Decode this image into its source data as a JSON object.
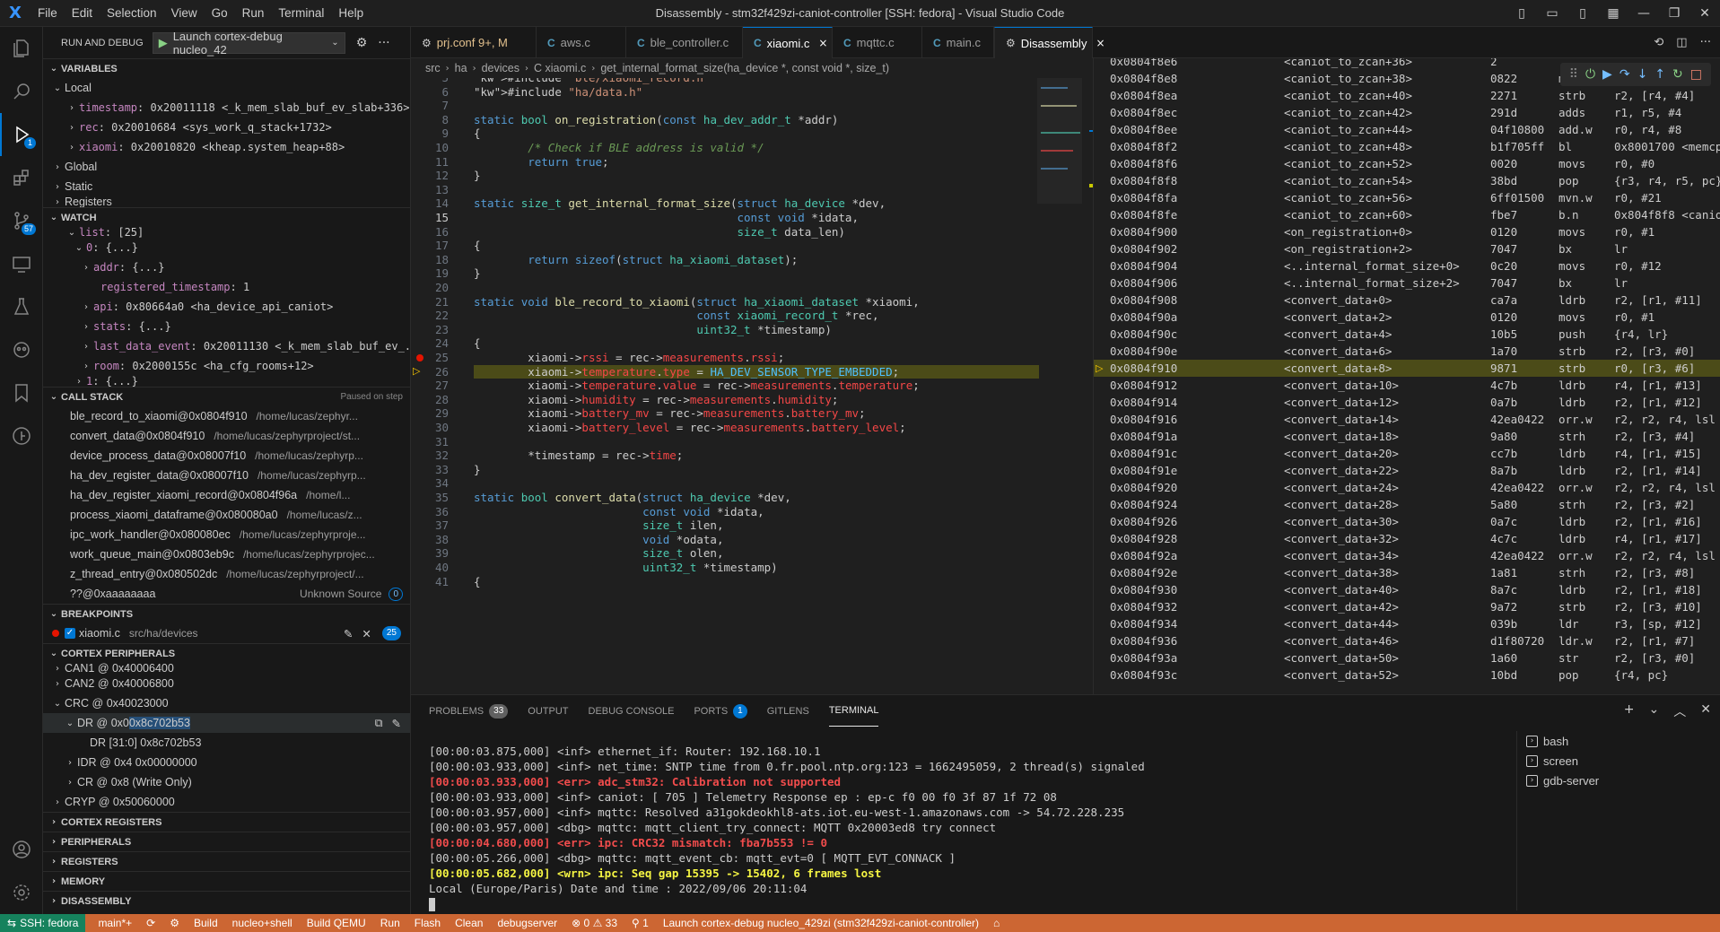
{
  "titlebar": {
    "logo": "X",
    "menu": [
      "File",
      "Edit",
      "Selection",
      "View",
      "Go",
      "Run",
      "Terminal",
      "Help"
    ],
    "title": "Disassembly - stm32f429zi-caniot-controller [SSH: fedora] - Visual Studio Code"
  },
  "activity": {
    "debug_badge": "1",
    "scm_badge": "57"
  },
  "sidebar": {
    "header": "RUN AND DEBUG",
    "launch": "Launch cortex-debug nucleo_42",
    "variables": {
      "title": "VARIABLES",
      "local": "Local",
      "items": [
        {
          "name": "timestamp",
          "value": ": 0x20011118 <_k_mem_slab_buf_ev_slab+336>"
        },
        {
          "name": "rec",
          "value": ": 0x20010684 <sys_work_q_stack+1732>"
        },
        {
          "name": "xiaomi",
          "value": ": 0x20010820 <kheap.system_heap+88>"
        }
      ],
      "global": "Global",
      "static": "Static",
      "registers": "Registers"
    },
    "watch": {
      "title": "WATCH",
      "rows": [
        {
          "name": "list",
          "value": ": [25]"
        },
        {
          "name": "0",
          "value": ": {...}"
        },
        {
          "name": "addr",
          "value": ": {...}"
        },
        {
          "name": "registered_timestamp",
          "value": ": 1"
        },
        {
          "name": "api",
          "value": ": 0x80664a0 <ha_device_api_caniot>"
        },
        {
          "name": "stats",
          "value": ": {...}"
        },
        {
          "name": "last_data_event",
          "value": ": 0x20011130 <_k_mem_slab_buf_ev_..."
        },
        {
          "name": "room",
          "value": ": 0x2000155c <ha_cfg_rooms+12>"
        },
        {
          "name": "1",
          "value": ": {...}"
        }
      ]
    },
    "callstack": {
      "title": "CALL STACK",
      "status": "Paused on step",
      "frames": [
        {
          "fn": "ble_record_to_xiaomi@0x0804f910",
          "path": "/home/lucas/zephyr..."
        },
        {
          "fn": "convert_data@0x0804f910",
          "path": "/home/lucas/zephyrproject/st..."
        },
        {
          "fn": "device_process_data@0x08007f10",
          "path": "/home/lucas/zephyrp..."
        },
        {
          "fn": "ha_dev_register_data@0x08007f10",
          "path": "/home/lucas/zephyrp..."
        },
        {
          "fn": "ha_dev_register_xiaomi_record@0x0804f96a",
          "path": "/home/l..."
        },
        {
          "fn": "process_xiaomi_dataframe@0x080080a0",
          "path": "/home/lucas/z..."
        },
        {
          "fn": "ipc_work_handler@0x080080ec",
          "path": "/home/lucas/zephyrproje..."
        },
        {
          "fn": "work_queue_main@0x0803eb9c",
          "path": "/home/lucas/zephyrprojec..."
        },
        {
          "fn": "z_thread_entry@0x080502dc",
          "path": "/home/lucas/zephyrproject/..."
        },
        {
          "fn": "??@0xaaaaaaaa",
          "path": "Unknown Source",
          "badge": "0"
        }
      ]
    },
    "breakpoints": {
      "title": "BREAKPOINTS",
      "file": "xiaomi.c",
      "path": "src/ha/devices",
      "count": "25"
    },
    "peripherals": {
      "title": "CORTEX PERIPHERALS",
      "rows": [
        {
          "label": "CAN1 @ 0x40006400",
          "indent": 1
        },
        {
          "label": "CAN2 @ 0x40006800",
          "indent": 1
        },
        {
          "label": "CRC @ 0x40023000",
          "indent": 1
        },
        {
          "label": "DR @ 0x0 ",
          "value": "0x8c702b53",
          "indent": 2
        },
        {
          "label": "DR [31:0] 0x8c702b53",
          "indent": 3
        },
        {
          "label": "IDR @ 0x4 0x00000000",
          "indent": 2
        },
        {
          "label": "CR @ 0x8 (Write Only)",
          "indent": 2
        },
        {
          "label": "CRYP @ 0x50060000",
          "indent": 1
        }
      ]
    },
    "bottom_sections": [
      "CORTEX REGISTERS",
      "PERIPHERALS",
      "REGISTERS",
      "MEMORY",
      "DISASSEMBLY"
    ]
  },
  "tabs": [
    {
      "icon": "⚙",
      "label": "prj.conf 9+, M",
      "modified": true
    },
    {
      "icon": "C",
      "label": "aws.c"
    },
    {
      "icon": "C",
      "label": "ble_controller.c"
    },
    {
      "icon": "C",
      "label": "xiaomi.c",
      "active": true,
      "close": "×"
    },
    {
      "icon": "C",
      "label": "mqttc.c"
    },
    {
      "icon": "C",
      "label": "main.c"
    },
    {
      "icon": "⚙",
      "label": "Disassembly",
      "active": true,
      "close": "×"
    }
  ],
  "breadcrumb": [
    "src",
    "ha",
    "devices",
    "C xiaomi.c",
    "get_internal_format_size(ha_device *, const void *, size_t)"
  ],
  "code": {
    "lines": [
      {
        "n": "5",
        "t": "#include \"ble/xiaomi_record.h\""
      },
      {
        "n": "6",
        "t": "#include \"ha/data.h\""
      },
      {
        "n": "7",
        "t": ""
      },
      {
        "n": "8",
        "t": "static bool on_registration(const ha_dev_addr_t *addr)"
      },
      {
        "n": "9",
        "t": "{"
      },
      {
        "n": "10",
        "t": "        /* Check if BLE address is valid */"
      },
      {
        "n": "11",
        "t": "        return true;"
      },
      {
        "n": "12",
        "t": "}"
      },
      {
        "n": "13",
        "t": ""
      },
      {
        "n": "14",
        "t": "static size_t get_internal_format_size(struct ha_device *dev,"
      },
      {
        "n": "15",
        "t": "                                       const void *idata,"
      },
      {
        "n": "16",
        "t": "                                       size_t data_len)"
      },
      {
        "n": "17",
        "t": "{"
      },
      {
        "n": "18",
        "t": "        return sizeof(struct ha_xiaomi_dataset);"
      },
      {
        "n": "19",
        "t": "}"
      },
      {
        "n": "20",
        "t": ""
      },
      {
        "n": "21",
        "t": "static void ble_record_to_xiaomi(struct ha_xiaomi_dataset *xiaomi,"
      },
      {
        "n": "22",
        "t": "                                 const xiaomi_record_t *rec,"
      },
      {
        "n": "23",
        "t": "                                 uint32_t *timestamp)"
      },
      {
        "n": "24",
        "t": "{"
      },
      {
        "n": "25",
        "t": "        xiaomi->rssi = rec->measurements.rssi;"
      },
      {
        "n": "26",
        "t": "        xiaomi->temperature.type = HA_DEV_SENSOR_TYPE_EMBEDDED;"
      },
      {
        "n": "27",
        "t": "        xiaomi->temperature.value = rec->measurements.temperature;"
      },
      {
        "n": "28",
        "t": "        xiaomi->humidity = rec->measurements.humidity;"
      },
      {
        "n": "29",
        "t": "        xiaomi->battery_mv = rec->measurements.battery_mv;"
      },
      {
        "n": "30",
        "t": "        xiaomi->battery_level = rec->measurements.battery_level;"
      },
      {
        "n": "31",
        "t": ""
      },
      {
        "n": "32",
        "t": "        *timestamp = rec->time;"
      },
      {
        "n": "33",
        "t": "}"
      },
      {
        "n": "34",
        "t": ""
      },
      {
        "n": "35",
        "t": "static bool convert_data(struct ha_device *dev,"
      },
      {
        "n": "36",
        "t": "                         const void *idata,"
      },
      {
        "n": "37",
        "t": "                         size_t ilen,"
      },
      {
        "n": "38",
        "t": "                         void *odata,"
      },
      {
        "n": "39",
        "t": "                         size_t olen,"
      },
      {
        "n": "40",
        "t": "                         uint32_t *timestamp)"
      },
      {
        "n": "41",
        "t": "{"
      }
    ]
  },
  "disasm": {
    "rows": [
      [
        "0x0804f8e6",
        "<caniot_to_zcan+36>",
        "2",
        "",
        ""
      ],
      [
        "0x0804f8e8",
        "<caniot_to_zcan+38>",
        "0822",
        "movs",
        "r2, #8"
      ],
      [
        "0x0804f8ea",
        "<caniot_to_zcan+40>",
        "2271",
        "strb",
        "r2, [r4, #4]"
      ],
      [
        "0x0804f8ec",
        "<caniot_to_zcan+42>",
        "291d",
        "adds",
        "r1, r5, #4"
      ],
      [
        "0x0804f8ee",
        "<caniot_to_zcan+44>",
        "04f10800",
        "add.w",
        "r0, r4, #8"
      ],
      [
        "0x0804f8f2",
        "<caniot_to_zcan+48>",
        "b1f705ff",
        "bl",
        "0x8001700 <memcpy>"
      ],
      [
        "0x0804f8f6",
        "<caniot_to_zcan+52>",
        "0020",
        "movs",
        "r0, #0"
      ],
      [
        "0x0804f8f8",
        "<caniot_to_zcan+54>",
        "38bd",
        "pop",
        "{r3, r4, r5, pc}"
      ],
      [
        "0x0804f8fa",
        "<caniot_to_zcan+56>",
        "6ff01500",
        "mvn.w",
        "r0, #21"
      ],
      [
        "0x0804f8fe",
        "<caniot_to_zcan+60>",
        "fbe7",
        "b.n",
        "0x804f8f8 <caniot_to"
      ],
      [
        "0x0804f900",
        "<on_registration+0>",
        "0120",
        "movs",
        "r0, #1"
      ],
      [
        "0x0804f902",
        "<on_registration+2>",
        "7047",
        "bx",
        "lr"
      ],
      [
        "0x0804f904",
        "<..internal_format_size+0>",
        "0c20",
        "movs",
        "r0, #12"
      ],
      [
        "0x0804f906",
        "<..internal_format_size+2>",
        "7047",
        "bx",
        "lr"
      ],
      [
        "0x0804f908",
        "<convert_data+0>",
        "ca7a",
        "ldrb",
        "r2, [r1, #11]"
      ],
      [
        "0x0804f90a",
        "<convert_data+2>",
        "0120",
        "movs",
        "r0, #1"
      ],
      [
        "0x0804f90c",
        "<convert_data+4>",
        "10b5",
        "push",
        "{r4, lr}"
      ],
      [
        "0x0804f90e",
        "<convert_data+6>",
        "1a70",
        "strb",
        "r2, [r3, #0]"
      ],
      [
        "0x0804f910",
        "<convert_data+8>",
        "9871",
        "strb",
        "r0, [r3, #6]"
      ],
      [
        "0x0804f912",
        "<convert_data+10>",
        "4c7b",
        "ldrb",
        "r4, [r1, #13]"
      ],
      [
        "0x0804f914",
        "<convert_data+12>",
        "0a7b",
        "ldrb",
        "r2, [r1, #12]"
      ],
      [
        "0x0804f916",
        "<convert_data+14>",
        "42ea0422",
        "orr.w",
        "r2, r2, r4, lsl #8"
      ],
      [
        "0x0804f91a",
        "<convert_data+18>",
        "9a80",
        "strh",
        "r2, [r3, #4]"
      ],
      [
        "0x0804f91c",
        "<convert_data+20>",
        "cc7b",
        "ldrb",
        "r4, [r1, #15]"
      ],
      [
        "0x0804f91e",
        "<convert_data+22>",
        "8a7b",
        "ldrb",
        "r2, [r1, #14]"
      ],
      [
        "0x0804f920",
        "<convert_data+24>",
        "42ea0422",
        "orr.w",
        "r2, r2, r4, lsl #8"
      ],
      [
        "0x0804f924",
        "<convert_data+28>",
        "5a80",
        "strh",
        "r2, [r3, #2]"
      ],
      [
        "0x0804f926",
        "<convert_data+30>",
        "0a7c",
        "ldrb",
        "r2, [r1, #16]"
      ],
      [
        "0x0804f928",
        "<convert_data+32>",
        "4c7c",
        "ldrb",
        "r4, [r1, #17]"
      ],
      [
        "0x0804f92a",
        "<convert_data+34>",
        "42ea0422",
        "orr.w",
        "r2, r2, r4, lsl #8"
      ],
      [
        "0x0804f92e",
        "<convert_data+38>",
        "1a81",
        "strh",
        "r2, [r3, #8]"
      ],
      [
        "0x0804f930",
        "<convert_data+40>",
        "8a7c",
        "ldrb",
        "r2, [r1, #18]"
      ],
      [
        "0x0804f932",
        "<convert_data+42>",
        "9a72",
        "strb",
        "r2, [r3, #10]"
      ],
      [
        "0x0804f934",
        "<convert_data+44>",
        "039b",
        "ldr",
        "r3, [sp, #12]"
      ],
      [
        "0x0804f936",
        "<convert_data+46>",
        "d1f80720",
        "ldr.w",
        "r2, [r1, #7]"
      ],
      [
        "0x0804f93a",
        "<convert_data+50>",
        "1a60",
        "str",
        "r2, [r3, #0]"
      ],
      [
        "0x0804f93c",
        "<convert_data+52>",
        "10bd",
        "pop",
        "{r4, pc}"
      ]
    ]
  },
  "panel": {
    "tabs": [
      {
        "label": "PROBLEMS",
        "badge": "33"
      },
      {
        "label": "OUTPUT"
      },
      {
        "label": "DEBUG CONSOLE"
      },
      {
        "label": "PORTS",
        "badge": "1"
      },
      {
        "label": "GITLENS"
      },
      {
        "label": "TERMINAL",
        "active": true
      }
    ],
    "terminal": [
      {
        "t": "[00:00:03.875,000] <inf> ethernet_if: Router: 192.168.10.1",
        "c": ""
      },
      {
        "t": "[00:00:03.933,000] <inf> net_time: SNTP time from 0.fr.pool.ntp.org:123 = 1662495059, 2 thread(s) signaled",
        "c": ""
      },
      {
        "t": "[00:00:03.933,000] <err> adc_stm32: Calibration not supported",
        "c": "err"
      },
      {
        "t": "[00:00:03.933,000] <inf> caniot: [ 705 ] Telemetry Response ep : ep-c f0 00 f0 3f 87 1f 72 08",
        "c": ""
      },
      {
        "t": "[00:00:03.957,000] <inf> mqttc: Resolved a31gokdeokhl8-ats.iot.eu-west-1.amazonaws.com -> 54.72.228.235",
        "c": ""
      },
      {
        "t": "[00:00:03.957,000] <dbg> mqttc: mqtt_client_try_connect: MQTT 0x20003ed8 try connect",
        "c": ""
      },
      {
        "t": "[00:00:04.680,000] <err> ipc: CRC32 mismatch: fba7b553 != 0",
        "c": "err"
      },
      {
        "t": "[00:00:05.266,000] <dbg> mqttc: mqtt_event_cb: mqtt_evt=0 [ MQTT_EVT_CONNACK ]",
        "c": ""
      },
      {
        "t": "[00:00:05.682,000] <wrn> ipc: Seq gap 15395 -> 15402, 6 frames lost",
        "c": "wrn"
      },
      {
        "t": "Local (Europe/Paris) Date and time : 2022/09/06 20:11:04",
        "c": ""
      }
    ],
    "terminals": [
      "bash",
      "screen",
      "gdb-server"
    ]
  },
  "statusbar": {
    "remote": "SSH: fedora",
    "items": [
      "main*+",
      "⟳",
      "⚙",
      "Build",
      "nucleo+shell",
      "Build QEMU",
      "Run",
      "Flash",
      "Clean",
      "debugserver",
      "⊗ 0 ⚠ 33",
      "⚲ 1",
      "Launch cortex-debug nucleo_429zi (stm32f429zi-caniot-controller)",
      "⌂"
    ]
  }
}
